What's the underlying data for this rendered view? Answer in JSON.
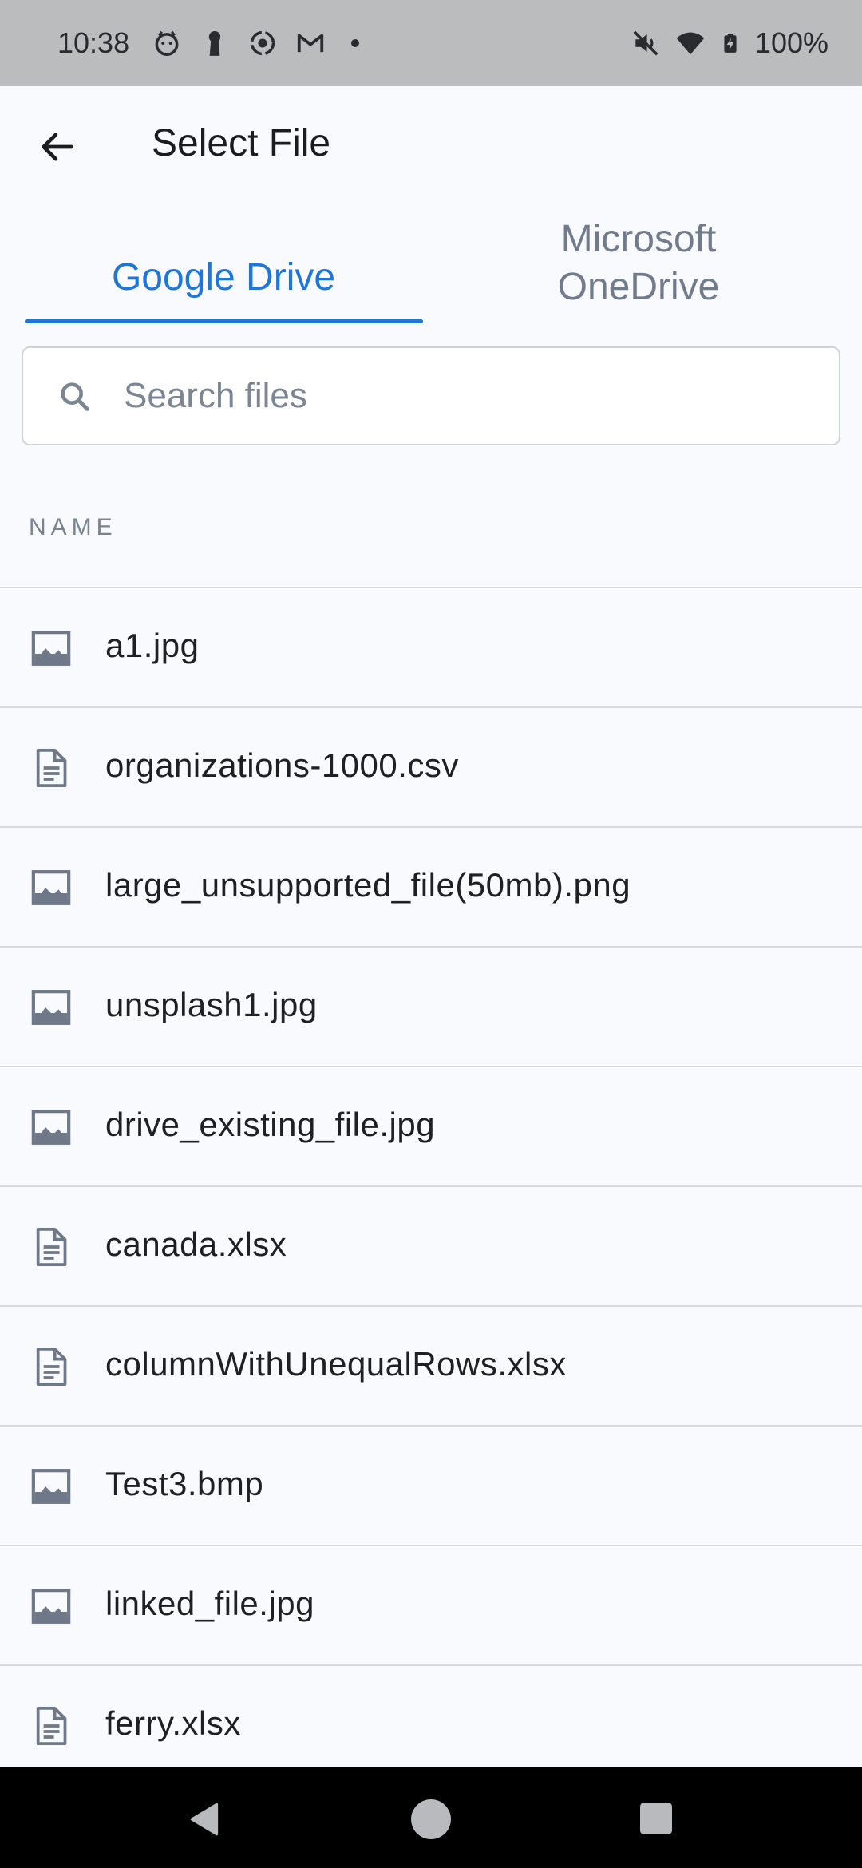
{
  "status_bar": {
    "time": "10:38",
    "battery": "100%"
  },
  "app_bar": {
    "title": "Select File"
  },
  "tabs": [
    {
      "label": "Google Drive",
      "selected": true
    },
    {
      "label": "Microsoft OneDrive",
      "selected": false
    }
  ],
  "search": {
    "placeholder": "Search files"
  },
  "list": {
    "header": "NAME",
    "files": [
      {
        "name": "a1.jpg",
        "icon": "image-icon"
      },
      {
        "name": "organizations-1000.csv",
        "icon": "document-icon"
      },
      {
        "name": "large_unsupported_file(50mb).png",
        "icon": "image-icon"
      },
      {
        "name": "unsplash1.jpg",
        "icon": "image-icon"
      },
      {
        "name": "drive_existing_file.jpg",
        "icon": "image-icon"
      },
      {
        "name": "canada.xlsx",
        "icon": "document-icon"
      },
      {
        "name": "columnWithUnequalRows.xlsx",
        "icon": "document-icon"
      },
      {
        "name": "Test3.bmp",
        "icon": "image-icon"
      },
      {
        "name": "linked_file.jpg",
        "icon": "image-icon"
      },
      {
        "name": "ferry.xlsx",
        "icon": "document-icon"
      }
    ]
  },
  "colors": {
    "accent": "#1f76d6",
    "inactive_tab": "#717b8c",
    "background": "#f8fafd",
    "icon": "#6f7888"
  }
}
